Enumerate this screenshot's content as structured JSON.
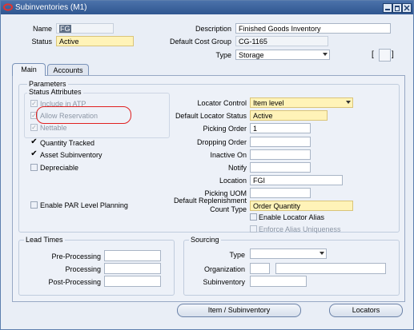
{
  "window": {
    "title": "Subinventories (M1)"
  },
  "header": {
    "name_label": "Name",
    "name_value": "FG",
    "status_label": "Status",
    "status_value": "Active",
    "description_label": "Description",
    "description_value": "Finished Goods Inventory",
    "cost_group_label": "Default Cost Group",
    "cost_group_value": "CG-1165",
    "type_label": "Type",
    "type_value": "Storage",
    "bracket_text": "[ ]"
  },
  "tabs": [
    {
      "label": "Main",
      "active": true
    },
    {
      "label": "Accounts",
      "active": false
    }
  ],
  "parameters": {
    "title": "Parameters",
    "status_attributes_title": "Status Attributes",
    "status_attributes": [
      {
        "label": "Include in ATP",
        "checked": true,
        "disabled": true
      },
      {
        "label": "Allow Reservation",
        "checked": true,
        "disabled": true
      },
      {
        "label": "Nettable",
        "checked": true,
        "disabled": true
      }
    ],
    "checkboxes": [
      {
        "label": "Quantity Tracked",
        "checked": true
      },
      {
        "label": "Asset Subinventory",
        "checked": true
      },
      {
        "label": "Depreciable",
        "checked": false
      }
    ],
    "par_planning": {
      "label": "Enable PAR Level Planning",
      "checked": false
    },
    "locator_control_label": "Locator Control",
    "locator_control_value": "Item level",
    "default_locator_status_label": "Default Locator Status",
    "default_locator_status_value": "Active",
    "picking_order_label": "Picking Order",
    "picking_order_value": "1",
    "dropping_order_label": "Dropping Order",
    "dropping_order_value": "",
    "inactive_on_label": "Inactive On",
    "inactive_on_value": "",
    "notify_label": "Notify",
    "notify_value": "",
    "location_label": "Location",
    "location_value": "FGI",
    "picking_uom_label": "Picking UOM",
    "picking_uom_value": "",
    "replenishment_label_1": "Default Replenishment",
    "replenishment_label_2": "Count Type",
    "replenishment_value": "Order Quantity",
    "enable_locator_alias": {
      "label": "Enable Locator Alias",
      "checked": false
    },
    "enforce_alias_uniqueness": {
      "label": "Enforce Alias Uniqueness",
      "checked": false,
      "disabled": true
    }
  },
  "lead_times": {
    "title": "Lead Times",
    "pre_processing_label": "Pre-Processing",
    "processing_label": "Processing",
    "post_processing_label": "Post-Processing",
    "pre_processing_value": "",
    "processing_value": "",
    "post_processing_value": ""
  },
  "sourcing": {
    "title": "Sourcing",
    "type_label": "Type",
    "type_value": "",
    "organization_label": "Organization",
    "organization_code": "",
    "organization_name": "",
    "subinventory_label": "Subinventory",
    "subinventory_value": ""
  },
  "buttons": {
    "item_subinventory": "Item / Subinventory",
    "locators": "Locators"
  },
  "colors": {
    "title_bar": "#3a609a",
    "required_field": "#fff3b8",
    "highlight_circle": "#e02020"
  }
}
